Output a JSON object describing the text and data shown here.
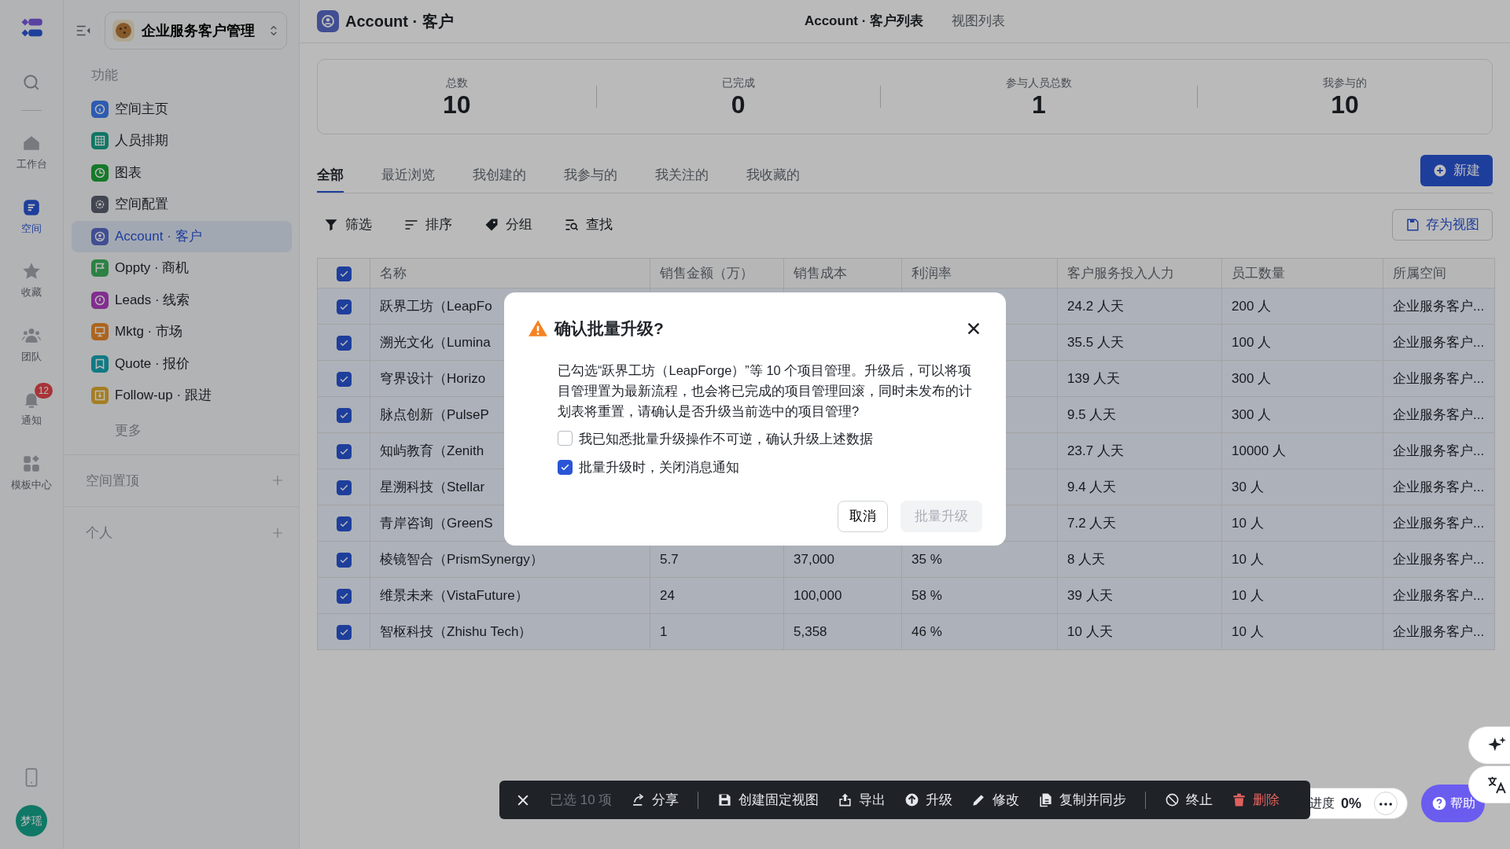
{
  "rail": {
    "items": [
      {
        "label": "工作台",
        "selected": false
      },
      {
        "label": "空间",
        "selected": true
      },
      {
        "label": "收藏",
        "selected": false
      },
      {
        "label": "团队",
        "selected": false
      },
      {
        "label": "通知",
        "selected": false,
        "badge": "12"
      },
      {
        "label": "模板中心",
        "selected": false
      }
    ],
    "avatar": "梦瑶"
  },
  "sidebar": {
    "workspace": "企业服务客户管理",
    "section": "功能",
    "items": [
      {
        "label": "空间主页",
        "color": "#2d5bb1",
        "selected": false
      },
      {
        "label": "人员排期",
        "color": "#0f7765",
        "selected": false
      },
      {
        "label": "图表",
        "color": "#16792a",
        "selected": false
      },
      {
        "label": "空间配置",
        "color": "#424652",
        "selected": false
      },
      {
        "label": "Account · 客户",
        "color": "#424e92",
        "selected": true
      },
      {
        "label": "Oppty · 商机",
        "color": "#2c8343",
        "selected": false
      },
      {
        "label": "Leads · 线索",
        "color": "#822e8f",
        "selected": false
      },
      {
        "label": "Mktg · 市场",
        "color": "#ae651f",
        "selected": false
      },
      {
        "label": "Quote · 报价",
        "color": "#117b84",
        "selected": false
      },
      {
        "label": "Follow-up · 跟进",
        "color": "#a67e22",
        "selected": false
      }
    ],
    "more": "更多",
    "groups": [
      "空间置顶",
      "个人"
    ]
  },
  "header": {
    "title": "Account · 客户",
    "tabs": [
      {
        "label": "Account · 客户列表",
        "selected": true
      },
      {
        "label": "视图列表",
        "selected": false
      }
    ]
  },
  "stats": [
    {
      "label": "总数",
      "value": "10"
    },
    {
      "label": "已完成",
      "value": "0"
    },
    {
      "label": "参与人员总数",
      "value": "1"
    },
    {
      "label": "我参与的",
      "value": "10"
    }
  ],
  "tabs": [
    {
      "label": "全部",
      "selected": true
    },
    {
      "label": "最近浏览",
      "selected": false
    },
    {
      "label": "我创建的",
      "selected": false
    },
    {
      "label": "我参与的",
      "selected": false
    },
    {
      "label": "我关注的",
      "selected": false
    },
    {
      "label": "我收藏的",
      "selected": false
    }
  ],
  "new_button": "新建",
  "toolbar": [
    "筛选",
    "排序",
    "分组",
    "查找"
  ],
  "save_view": "存为视图",
  "table": {
    "all_checked": true,
    "columns": [
      "名称",
      "销售金额（万）",
      "销售成本",
      "利润率",
      "客户服务投入人力",
      "员工数量",
      "所属空间"
    ],
    "rows": [
      {
        "checked": true,
        "cells": [
          "跃界工坊（LeapFo",
          null,
          null,
          null,
          "24.2 人天",
          "200 人",
          "企业服务客户..."
        ]
      },
      {
        "checked": true,
        "cells": [
          "溯光文化（Lumina",
          null,
          null,
          null,
          "35.5 人天",
          "100 人",
          "企业服务客户..."
        ]
      },
      {
        "checked": true,
        "cells": [
          "穹界设计（Horizo",
          null,
          null,
          null,
          "139 人天",
          "300 人",
          "企业服务客户..."
        ]
      },
      {
        "checked": true,
        "cells": [
          "脉点创新（PulseP",
          null,
          null,
          null,
          "9.5 人天",
          "300 人",
          "企业服务客户..."
        ]
      },
      {
        "checked": true,
        "cells": [
          "知屿教育（Zenith",
          null,
          null,
          null,
          "23.7 人天",
          "10000 人",
          "企业服务客户..."
        ]
      },
      {
        "checked": true,
        "cells": [
          "星溯科技（Stellar",
          null,
          null,
          null,
          "9.4 人天",
          "30 人",
          "企业服务客户..."
        ]
      },
      {
        "checked": true,
        "cells": [
          "青岸咨询（GreenS",
          null,
          null,
          null,
          "7.2 人天",
          "10 人",
          "企业服务客户..."
        ]
      },
      {
        "checked": true,
        "cells": [
          "棱镜智合（PrismSynergy）",
          "5.7",
          "37,000",
          "35 %",
          "8 人天",
          "10 人",
          "企业服务客户..."
        ]
      },
      {
        "checked": true,
        "cells": [
          "维景未来（VistaFuture）",
          "24",
          "100,000",
          "58 %",
          "39 人天",
          "10 人",
          "企业服务客户..."
        ]
      },
      {
        "checked": true,
        "cells": [
          "智枢科技（Zhishu Tech）",
          "1",
          "5,358",
          "46 %",
          "10 人天",
          "10 人",
          "企业服务客户..."
        ]
      }
    ]
  },
  "dialog": {
    "title": "确认批量升级?",
    "body": "已勾选“跃界工坊（LeapForge）”等 10 个项目管理。升级后，可以将项目管理置为最新流程，也会将已完成的项目管理回滚，同时未发布的计划表将重置，请确认是否升级当前选中的项目管理?",
    "options": [
      {
        "label": "我已知悉批量升级操作不可逆，确认升级上述数据",
        "checked": false
      },
      {
        "label": "批量升级时，关闭消息通知",
        "checked": true
      }
    ],
    "buttons": [
      {
        "label": "取消",
        "kind": "secondary",
        "disabled": false
      },
      {
        "label": "批量升级",
        "kind": "primary",
        "disabled": true
      }
    ]
  },
  "bulk_bar": {
    "count": "已选 10 项",
    "groups": [
      [
        {
          "label": "分享",
          "kind": "normal"
        }
      ],
      [
        {
          "label": "创建固定视图",
          "kind": "normal"
        },
        {
          "label": "导出",
          "kind": "normal"
        },
        {
          "label": "升级",
          "kind": "normal"
        },
        {
          "label": "修改",
          "kind": "normal"
        },
        {
          "label": "复制并同步",
          "kind": "normal"
        }
      ],
      [
        {
          "label": "终止",
          "kind": "normal"
        },
        {
          "label": "删除",
          "kind": "danger"
        }
      ]
    ]
  },
  "progress": {
    "label": "进度",
    "value": "0%"
  },
  "help": "帮助"
}
